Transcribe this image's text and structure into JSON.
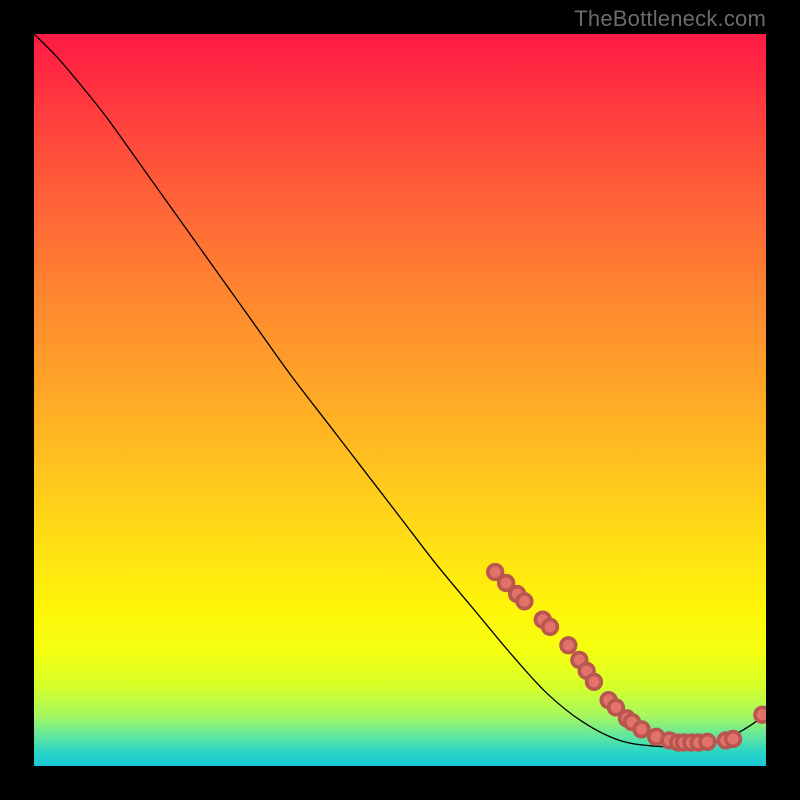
{
  "watermark": "TheBottleneck.com",
  "colors": {
    "page_bg": "#000000",
    "watermark": "#6b6b6b",
    "curve": "#000000",
    "dot_fill": "#e2736a",
    "dot_stroke": "#b9564f",
    "gradient_stops": [
      "#ff1a44",
      "#ff3a3e",
      "#ff6038",
      "#ff8430",
      "#ffa528",
      "#ffc51e",
      "#ffe014",
      "#fff40a",
      "#f6ff10",
      "#d8ff28",
      "#a8f85e",
      "#5fe6a0",
      "#2cd6c4",
      "#18c9d8"
    ]
  },
  "chart_data": {
    "type": "line",
    "title": "",
    "xlabel": "",
    "ylabel": "",
    "xlim": [
      0,
      100
    ],
    "ylim": [
      0,
      100
    ],
    "note": "x,y in 0–100 plot-area units; y increases downward as drawn (top=0). Curve is a smooth descending line from top-left to a flat trough near bottom-right, then a small uptick at far right. Dots mark sampled points along the lower segment.",
    "series": [
      {
        "name": "bottleneck-curve",
        "points": [
          {
            "x": 0.0,
            "y": 0.0
          },
          {
            "x": 3.0,
            "y": 3.0
          },
          {
            "x": 6.0,
            "y": 6.5
          },
          {
            "x": 10.0,
            "y": 11.5
          },
          {
            "x": 15.0,
            "y": 18.5
          },
          {
            "x": 20.0,
            "y": 25.5
          },
          {
            "x": 25.0,
            "y": 32.5
          },
          {
            "x": 30.0,
            "y": 39.5
          },
          {
            "x": 35.0,
            "y": 46.5
          },
          {
            "x": 40.0,
            "y": 53.0
          },
          {
            "x": 45.0,
            "y": 59.5
          },
          {
            "x": 50.0,
            "y": 66.0
          },
          {
            "x": 55.0,
            "y": 72.5
          },
          {
            "x": 60.0,
            "y": 78.5
          },
          {
            "x": 65.0,
            "y": 84.5
          },
          {
            "x": 70.0,
            "y": 90.0
          },
          {
            "x": 75.0,
            "y": 94.0
          },
          {
            "x": 80.0,
            "y": 96.5
          },
          {
            "x": 85.0,
            "y": 97.3
          },
          {
            "x": 90.0,
            "y": 97.3
          },
          {
            "x": 94.0,
            "y": 96.5
          },
          {
            "x": 97.0,
            "y": 95.0
          },
          {
            "x": 100.0,
            "y": 93.0
          }
        ]
      }
    ],
    "dots": [
      {
        "x": 63.0,
        "y": 73.5,
        "r": 1.0
      },
      {
        "x": 64.5,
        "y": 75.0,
        "r": 1.0
      },
      {
        "x": 66.0,
        "y": 76.5,
        "r": 1.0
      },
      {
        "x": 67.0,
        "y": 77.5,
        "r": 1.0
      },
      {
        "x": 69.5,
        "y": 80.0,
        "r": 1.0
      },
      {
        "x": 70.5,
        "y": 81.0,
        "r": 1.0
      },
      {
        "x": 73.0,
        "y": 83.5,
        "r": 1.0
      },
      {
        "x": 74.5,
        "y": 85.5,
        "r": 1.0
      },
      {
        "x": 75.5,
        "y": 87.0,
        "r": 1.0
      },
      {
        "x": 76.5,
        "y": 88.5,
        "r": 1.0
      },
      {
        "x": 78.5,
        "y": 91.0,
        "r": 1.0
      },
      {
        "x": 79.5,
        "y": 92.0,
        "r": 1.0
      },
      {
        "x": 81.0,
        "y": 93.5,
        "r": 1.0
      },
      {
        "x": 81.7,
        "y": 94.0,
        "r": 1.0
      },
      {
        "x": 83.0,
        "y": 95.0,
        "r": 1.0
      },
      {
        "x": 85.0,
        "y": 96.0,
        "r": 1.0
      },
      {
        "x": 86.8,
        "y": 96.5,
        "r": 1.0
      },
      {
        "x": 88.0,
        "y": 96.8,
        "r": 1.0
      },
      {
        "x": 88.8,
        "y": 96.8,
        "r": 1.0
      },
      {
        "x": 89.8,
        "y": 96.8,
        "r": 1.0
      },
      {
        "x": 90.8,
        "y": 96.8,
        "r": 1.0
      },
      {
        "x": 92.0,
        "y": 96.7,
        "r": 1.0
      },
      {
        "x": 94.5,
        "y": 96.5,
        "r": 1.0
      },
      {
        "x": 95.5,
        "y": 96.3,
        "r": 1.0
      },
      {
        "x": 99.5,
        "y": 93.0,
        "r": 1.0
      }
    ]
  }
}
